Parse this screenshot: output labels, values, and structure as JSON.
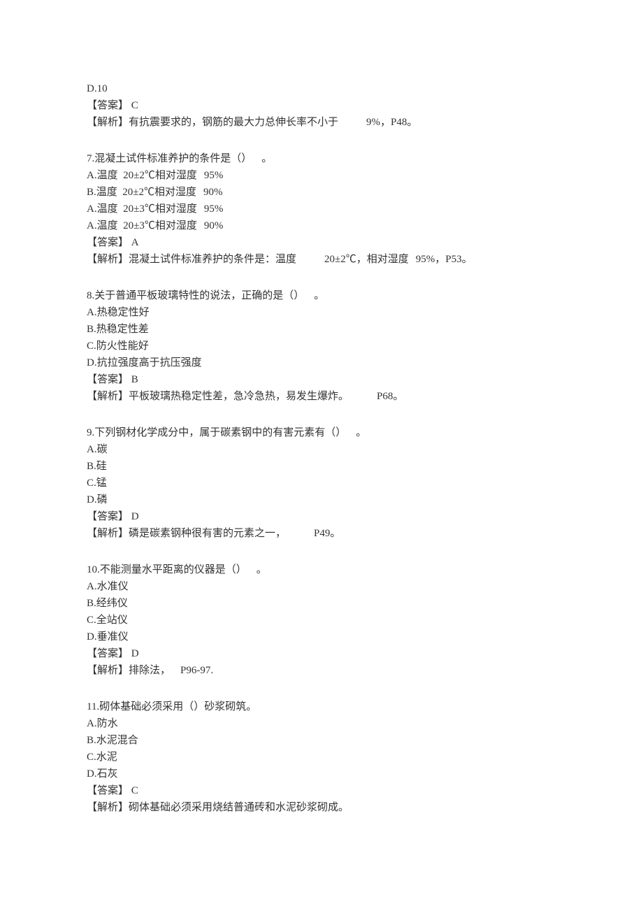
{
  "q6tail": {
    "optD": "D.10",
    "ans_label": "【答案】",
    "ans": " C",
    "exp_label": "【解析】",
    "exp_a": "有抗震要求的，钢筋的最大力总伸长率不小于",
    "exp_b": "9%，P48。"
  },
  "q7": {
    "stem_a": "7.混凝土试件标准养护的条件是（）",
    "stem_b": "。",
    "optA_a": "A.温度  20±2℃相对湿度",
    "optA_b": "95%",
    "optB_a": "B.温度  20±2℃相对湿度",
    "optB_b": "90%",
    "optC_a": "A.温度  20±3℃相对湿度",
    "optC_b": "95%",
    "optD_a": "A.温度  20±3℃相对湿度",
    "optD_b": "90%",
    "ans_label": "【答案】",
    "ans": " A",
    "exp_label": "【解析】",
    "exp_a": "混凝土试件标准养护的条件是：温度",
    "exp_b": "20±2℃，相对湿度",
    "exp_c": "95%，P53。"
  },
  "q8": {
    "stem_a": "8.关于普通平板玻璃特性的说法，正确的是（）",
    "stem_b": "。",
    "optA": "A.热稳定性好",
    "optB": "B.热稳定性差",
    "optC": "C.防火性能好",
    "optD": "D.抗拉强度高于抗压强度",
    "ans_label": "【答案】",
    "ans": " B",
    "exp_label": "【解析】",
    "exp_a": "平板玻璃热稳定性差，急冷急热，易发生爆炸。",
    "exp_b": "P68。"
  },
  "q9": {
    "stem_a": "9.下列钢材化学成分中，属于碳素钢中的有害元素有（）",
    "stem_b": "。",
    "optA": "A.碳",
    "optB": "B.硅",
    "optC": "C.锰",
    "optD": "D.磷",
    "ans_label": "【答案】",
    "ans": " D",
    "exp_label": "【解析】",
    "exp_a": "磷是碳素钢种很有害的元素之一，",
    "exp_b": "P49。"
  },
  "q10": {
    "stem_a": "10.不能测量水平距离的仪器是（）",
    "stem_b": "。",
    "optA": "A.水准仪",
    "optB": "B.经纬仪",
    "optC": "C.全站仪",
    "optD": "D.垂准仪",
    "ans_label": "【答案】",
    "ans": " D",
    "exp_label": "【解析】",
    "exp_a": "排除法，",
    "exp_b": "P96-97."
  },
  "q11": {
    "stem": "11.砌体基础必须采用（）砂浆砌筑。",
    "optA": "A.防水",
    "optB": "B.水泥混合",
    "optC": "C.水泥",
    "optD": "D.石灰",
    "ans_label": "【答案】",
    "ans": " C",
    "exp_label": "【解析】",
    "exp": "砌体基础必须采用烧结普通砖和水泥砂浆砌成。"
  }
}
